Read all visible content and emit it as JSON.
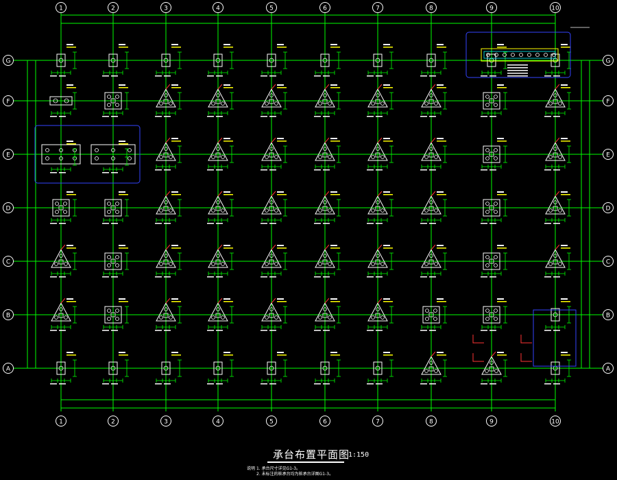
{
  "drawing": {
    "title": "承台布置平面图",
    "scale": "1:150",
    "notes_label": "说明",
    "notes": [
      "1. 承台尺寸详见G1-3。",
      "2. 未标注的桩承台均为桩承台详图G1-3。"
    ]
  },
  "grid": {
    "columns": [
      "1",
      "2",
      "3",
      "4",
      "5",
      "6",
      "7",
      "8",
      "9",
      "10"
    ],
    "rows": [
      "A",
      "B",
      "C",
      "D",
      "E",
      "F",
      "G"
    ]
  },
  "colors": {
    "background": "#000000",
    "grid_line": "#00ff00",
    "pile_cap": "#ffffff",
    "axis_bubble": "#ffffff",
    "highlight_box": "#3344ff",
    "annotation_red": "#ff3333",
    "annotation_yellow": "#ffff00",
    "annotation_cyan": "#00ffff"
  },
  "pile_caps": {
    "types": [
      "square",
      "triangle",
      "single",
      "double"
    ],
    "layout": {
      "G": [
        "single",
        "single",
        "single",
        "single",
        "single",
        "single",
        "single",
        "single",
        "single",
        "single"
      ],
      "F": [
        "double",
        "square",
        "triangle",
        "triangle",
        "triangle",
        "triangle",
        "triangle",
        "triangle",
        "square",
        "triangle"
      ],
      "E": [
        "",
        "",
        "triangle",
        "triangle",
        "triangle",
        "triangle",
        "triangle",
        "triangle",
        "square",
        "triangle"
      ],
      "D": [
        "square",
        "square",
        "triangle",
        "triangle",
        "triangle",
        "triangle",
        "triangle",
        "triangle",
        "square",
        "triangle"
      ],
      "C": [
        "triangle",
        "square",
        "triangle",
        "triangle",
        "triangle",
        "triangle",
        "triangle",
        "triangle",
        "square",
        "triangle"
      ],
      "B": [
        "triangle",
        "square",
        "triangle",
        "triangle",
        "triangle",
        "triangle",
        "triangle",
        "square",
        "square",
        "single"
      ],
      "A": [
        "single",
        "single",
        "single",
        "single",
        "single",
        "single",
        "single",
        "triangle",
        "triangle",
        "single"
      ]
    }
  }
}
